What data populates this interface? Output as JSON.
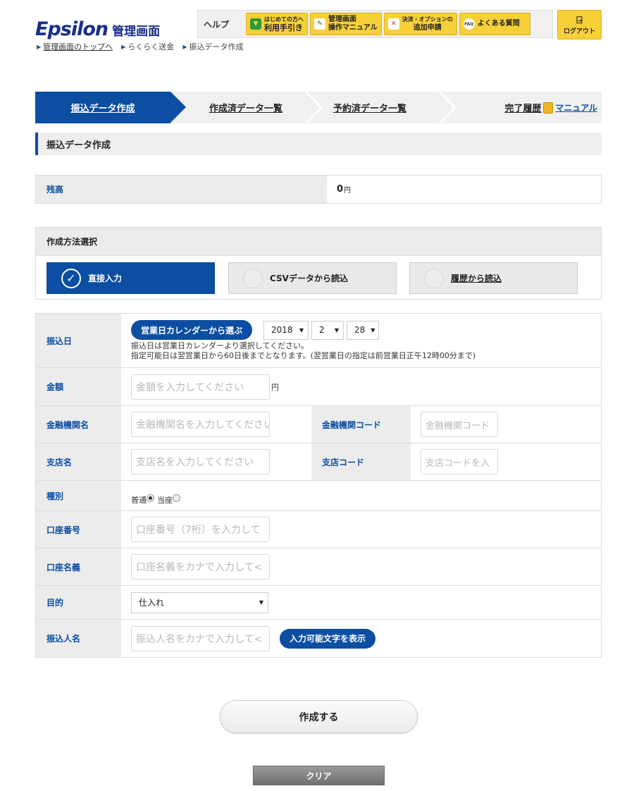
{
  "header": {
    "logo_text": "Epsilon",
    "logo_sub": "管理画面",
    "breadcrumb": [
      {
        "label": "管理画面のトップへ"
      },
      {
        "label": "らくらく送金"
      },
      {
        "label": "振込データ作成"
      }
    ],
    "help_label": "ヘルプ",
    "help_buttons": [
      {
        "icon": "beginner-leaf-icon",
        "line1": "はじめての方へ",
        "line2": "利用手引き"
      },
      {
        "icon": "pencil-icon",
        "line1": "管理画面",
        "line2": "操作マニュアル"
      },
      {
        "icon": "tools-icon",
        "line1": "決済・オプションの",
        "line2": "追加申請"
      },
      {
        "icon": "faq-icon",
        "line1": "よくある質問",
        "line2": ""
      }
    ],
    "logout_label": "ログアウト"
  },
  "steps": [
    {
      "label": "振込データ作成"
    },
    {
      "label": "作成済データ一覧"
    },
    {
      "label": "予約済データ一覧"
    },
    {
      "label": "完了履歴"
    }
  ],
  "manual_link": "マニュアル",
  "section_title": "振込データ作成",
  "balance": {
    "label": "残高",
    "value": "0",
    "unit": "円"
  },
  "method": {
    "title": "作成方法選択",
    "options": [
      {
        "label": "直接入力",
        "selected": true
      },
      {
        "label": "CSVデータから読込",
        "selected": false
      },
      {
        "label": "履歴から読込",
        "selected": false
      }
    ]
  },
  "form": {
    "transfer_date": {
      "label": "振込日",
      "calendar_button": "営業日カレンダーから選ぶ",
      "year": "2018",
      "month": "2",
      "day": "28",
      "note1": "振込日は営業日カレンダーより選択してください。",
      "note2": "指定可能日は翌営業日から60日後までとなります。(翌営業日の指定は前営業日正午12時00分まで)"
    },
    "amount": {
      "label": "金額",
      "placeholder": "金額を入力してください",
      "unit": "円"
    },
    "bank_name": {
      "label": "金融機関名",
      "placeholder": "金融機関名を入力してください"
    },
    "bank_code": {
      "label": "金融機関コード",
      "placeholder": "金融機関コード"
    },
    "branch_name": {
      "label": "支店名",
      "placeholder": "支店名を入力してください"
    },
    "branch_code": {
      "label": "支店コード",
      "placeholder": "支店コードを入"
    },
    "account_type": {
      "label": "種別",
      "option1": "普通",
      "option2": "当座",
      "selected": "普通"
    },
    "account_number": {
      "label": "口座番号",
      "placeholder": "口座番号（7桁）を入力して"
    },
    "account_name": {
      "label": "口座名義",
      "placeholder": "口座名義をカナで入力して<"
    },
    "purpose": {
      "label": "目的",
      "selected": "仕入れ"
    },
    "sender_name": {
      "label": "振込人名",
      "placeholder": "振込人名をカナで入力して<",
      "chars_button": "入力可能文字を表示"
    }
  },
  "buttons": {
    "create": "作成する",
    "clear": "クリア"
  },
  "colors": {
    "primary": "#0b4ea2",
    "accent_yellow": "#f7d038"
  }
}
